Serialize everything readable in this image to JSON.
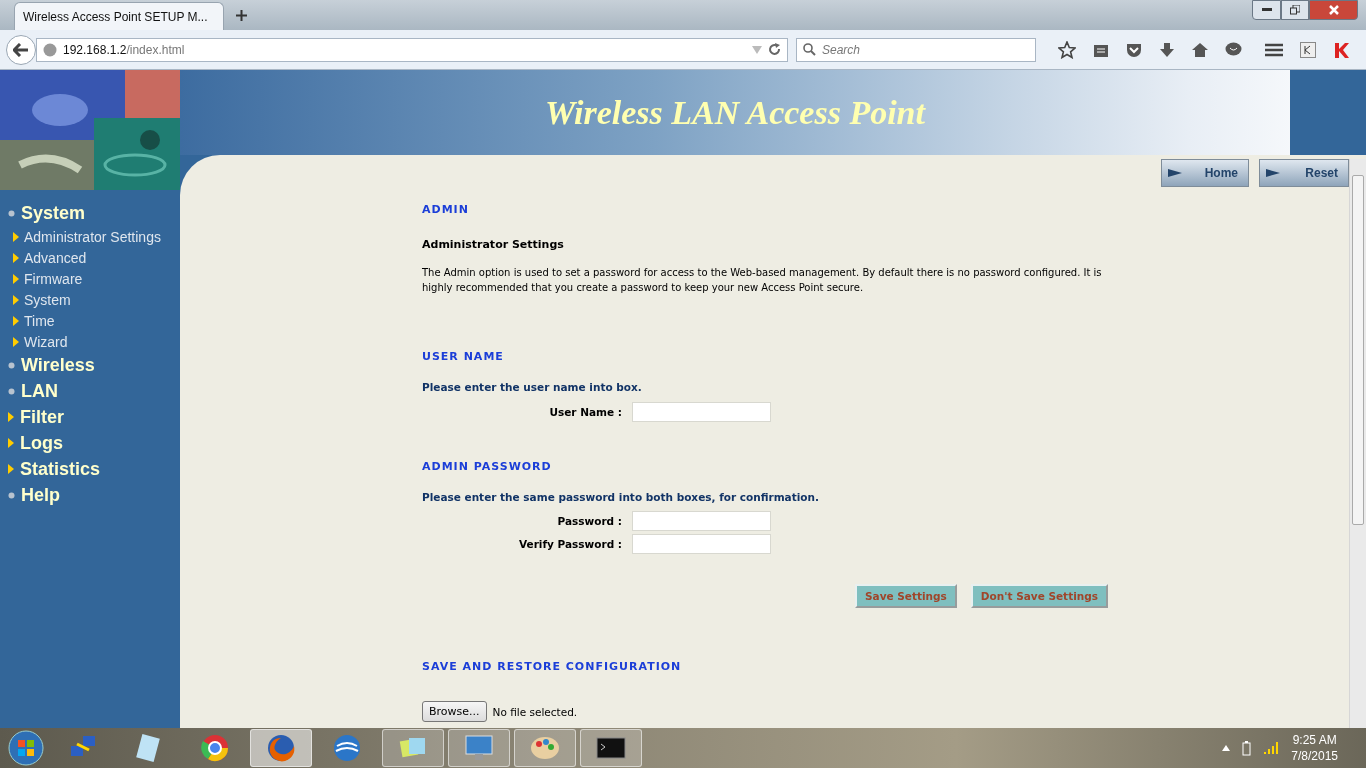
{
  "browser": {
    "tab_title": "Wireless Access Point SETUP M...",
    "url": {
      "host": "192.168.1.2",
      "path": "/index.html"
    },
    "search": {
      "placeholder": "Search"
    }
  },
  "page": {
    "banner_title": "Wireless LAN Access Point",
    "top_buttons": [
      "Home",
      "Reset"
    ],
    "sidebar": {
      "items": [
        {
          "label": "System",
          "kind": "dot",
          "children": [
            {
              "label": "Administrator Settings"
            },
            {
              "label": "Advanced"
            },
            {
              "label": "Firmware"
            },
            {
              "label": "System"
            },
            {
              "label": "Time"
            },
            {
              "label": "Wizard"
            }
          ]
        },
        {
          "label": "Wireless",
          "kind": "dot"
        },
        {
          "label": "LAN",
          "kind": "dot"
        },
        {
          "label": "Filter",
          "kind": "arrow"
        },
        {
          "label": "Logs",
          "kind": "arrow"
        },
        {
          "label": "Statistics",
          "kind": "arrow"
        },
        {
          "label": "Help",
          "kind": "dot"
        }
      ]
    },
    "admin": {
      "heading": "ADMIN",
      "subheading": "Administrator Settings",
      "description": "The Admin option is used to set a password for access to the Web-based management. By default there is no password configured. It is highly recommended that you create a password to keep your new Access Point secure."
    },
    "user_name": {
      "heading": "USER NAME",
      "prompt": "Please enter the user name into box.",
      "fields": [
        {
          "label": "User Name :"
        }
      ]
    },
    "admin_password": {
      "heading": "ADMIN PASSWORD",
      "prompt": "Please enter the same password into both boxes, for confirmation.",
      "fields": [
        {
          "label": "Password :"
        },
        {
          "label": "Verify Password :"
        }
      ]
    },
    "actions": [
      "Save Settings",
      "Don't Save Settings"
    ],
    "save_restore": {
      "heading": "SAVE AND RESTORE CONFIGURATION",
      "browse_button": "Browse...",
      "file_status": "No file selected."
    }
  },
  "taskbar": {
    "apps": [
      {
        "kind": "network",
        "running": false,
        "selected": false
      },
      {
        "kind": "notepad",
        "running": false,
        "selected": false
      },
      {
        "kind": "chrome",
        "running": false,
        "selected": false
      },
      {
        "kind": "firefox",
        "running": true,
        "selected": true
      },
      {
        "kind": "globe",
        "running": false,
        "selected": false
      },
      {
        "kind": "folder",
        "running": true,
        "selected": false
      },
      {
        "kind": "monitor",
        "running": true,
        "selected": false
      },
      {
        "kind": "paint",
        "running": true,
        "selected": false
      },
      {
        "kind": "terminal",
        "running": true,
        "selected": false
      }
    ],
    "time": "9:25 AM",
    "date": "7/8/2015"
  }
}
